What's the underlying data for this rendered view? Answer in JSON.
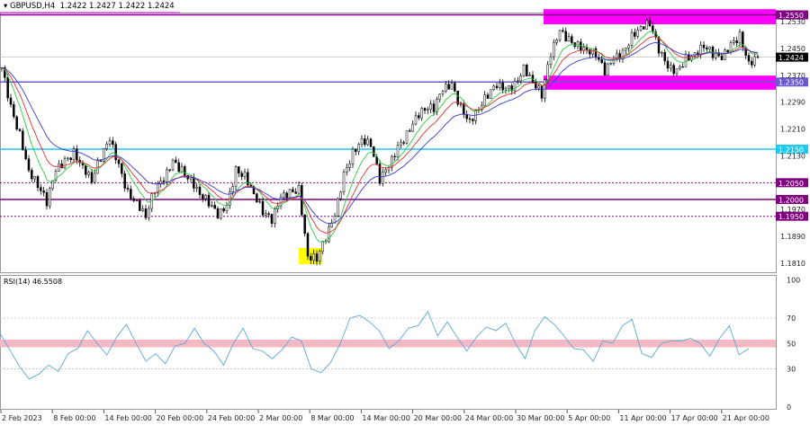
{
  "header": {
    "symbol": "GBPUSD,H4",
    "ohlc": "1.2422 1.2427 1.2422 1.2424"
  },
  "rsi_title": "RSI(14) 46.5508",
  "colors": {
    "zone": "#ff00ff",
    "level_purple": "#800080",
    "level_blue": "#6a5acd",
    "level_cyan": "#1ec8f0",
    "rsi_line": "#5aa8d8",
    "rsi_band": "#f7b8c4",
    "ma_fast": "#2ecc40",
    "ma_mid": "#e03030",
    "ma_slow": "#3a3ad0",
    "highlight": "#ffff00"
  },
  "chart_data": [
    {
      "type": "candlestick",
      "title": "GBPUSD,H4",
      "ylim": [
        1.179,
        1.258
      ],
      "price_ticks": [
        "1.2530",
        "1.2450",
        "1.2370",
        "1.2290",
        "1.2210",
        "1.2130",
        "1.1970",
        "1.1890",
        "1.1810"
      ],
      "current_price": "1.2424",
      "levels": [
        {
          "label": "1.2550",
          "value": 1.255,
          "style": "solid",
          "color": "#800080"
        },
        {
          "label": "1.2350",
          "value": 1.235,
          "style": "solid",
          "color": "#6a5acd"
        },
        {
          "label": "1.2150",
          "value": 1.215,
          "style": "solid",
          "color": "#1ec8f0"
        },
        {
          "label": "1.2050",
          "value": 1.205,
          "style": "dotted",
          "color": "#800080"
        },
        {
          "label": "1.2000",
          "value": 1.2,
          "style": "solid",
          "color": "#800080"
        },
        {
          "label": "1.1950",
          "value": 1.195,
          "style": "dotted",
          "color": "#800080"
        }
      ],
      "zones": [
        {
          "from": 1.2522,
          "to": 1.2567
        },
        {
          "from": 1.2327,
          "to": 1.2369
        }
      ],
      "closes": [
        1.2393,
        1.2273,
        1.2193,
        1.2086,
        1.2045,
        1.1992,
        1.2086,
        1.2112,
        1.2139,
        1.2099,
        1.2059,
        1.2126,
        1.2179,
        1.2099,
        1.2019,
        1.1992,
        1.1952,
        1.2032,
        1.2059,
        1.2112,
        1.2086,
        1.2059,
        1.2019,
        1.1992,
        1.1952,
        1.1979,
        1.2086,
        1.2072,
        1.2019,
        1.1965,
        1.1938,
        1.2005,
        1.2019,
        1.2032,
        1.1831,
        1.1826,
        1.1885,
        1.1952,
        1.2072,
        1.2139,
        1.2179,
        1.2166,
        1.2059,
        1.2099,
        1.2153,
        1.2193,
        1.2246,
        1.2273,
        1.2273,
        1.2327,
        1.234,
        1.2273,
        1.2233,
        1.2273,
        1.2313,
        1.234,
        1.2327,
        1.234,
        1.2393,
        1.2353,
        1.2313,
        1.2434,
        1.2501,
        1.2474,
        1.246,
        1.2447,
        1.2434,
        1.238,
        1.242,
        1.2434,
        1.2487,
        1.2514,
        1.2527,
        1.2447,
        1.2393,
        1.238,
        1.242,
        1.2434,
        1.246,
        1.2434,
        1.242,
        1.246,
        1.2487,
        1.2407,
        1.2424
      ],
      "time_labels": [
        "2 Feb 2023",
        "8 Feb 00:00",
        "14 Feb 00:00",
        "20 Feb 00:00",
        "24 Feb 00:00",
        "2 Mar 00:00",
        "8 Mar 00:00",
        "14 Mar 00:00",
        "20 Mar 00:00",
        "24 Mar 00:00",
        "30 Mar 00:00",
        "5 Apr 00:00",
        "11 Apr 00:00",
        "17 Apr 00:00",
        "21 Apr 00:00"
      ]
    },
    {
      "type": "line",
      "title": "RSI(14) 46.5508",
      "ylim": [
        0,
        100
      ],
      "ticks": [
        "100",
        "70",
        "50",
        "30",
        "0"
      ],
      "levels": [
        30,
        50,
        70
      ],
      "values": [
        58,
        45,
        32,
        22,
        26,
        33,
        28,
        42,
        46,
        60,
        50,
        41,
        55,
        65,
        50,
        36,
        42,
        34,
        48,
        50,
        62,
        50,
        44,
        33,
        50,
        62,
        46,
        44,
        38,
        45,
        55,
        52,
        30,
        27,
        35,
        50,
        70,
        72,
        67,
        60,
        46,
        52,
        62,
        64,
        75,
        56,
        67,
        55,
        44,
        55,
        63,
        60,
        66,
        50,
        38,
        60,
        71,
        65,
        56,
        46,
        45,
        36,
        52,
        50,
        64,
        69,
        42,
        39,
        50,
        52,
        52,
        54,
        50,
        40,
        54,
        64,
        41,
        46
      ]
    }
  ]
}
